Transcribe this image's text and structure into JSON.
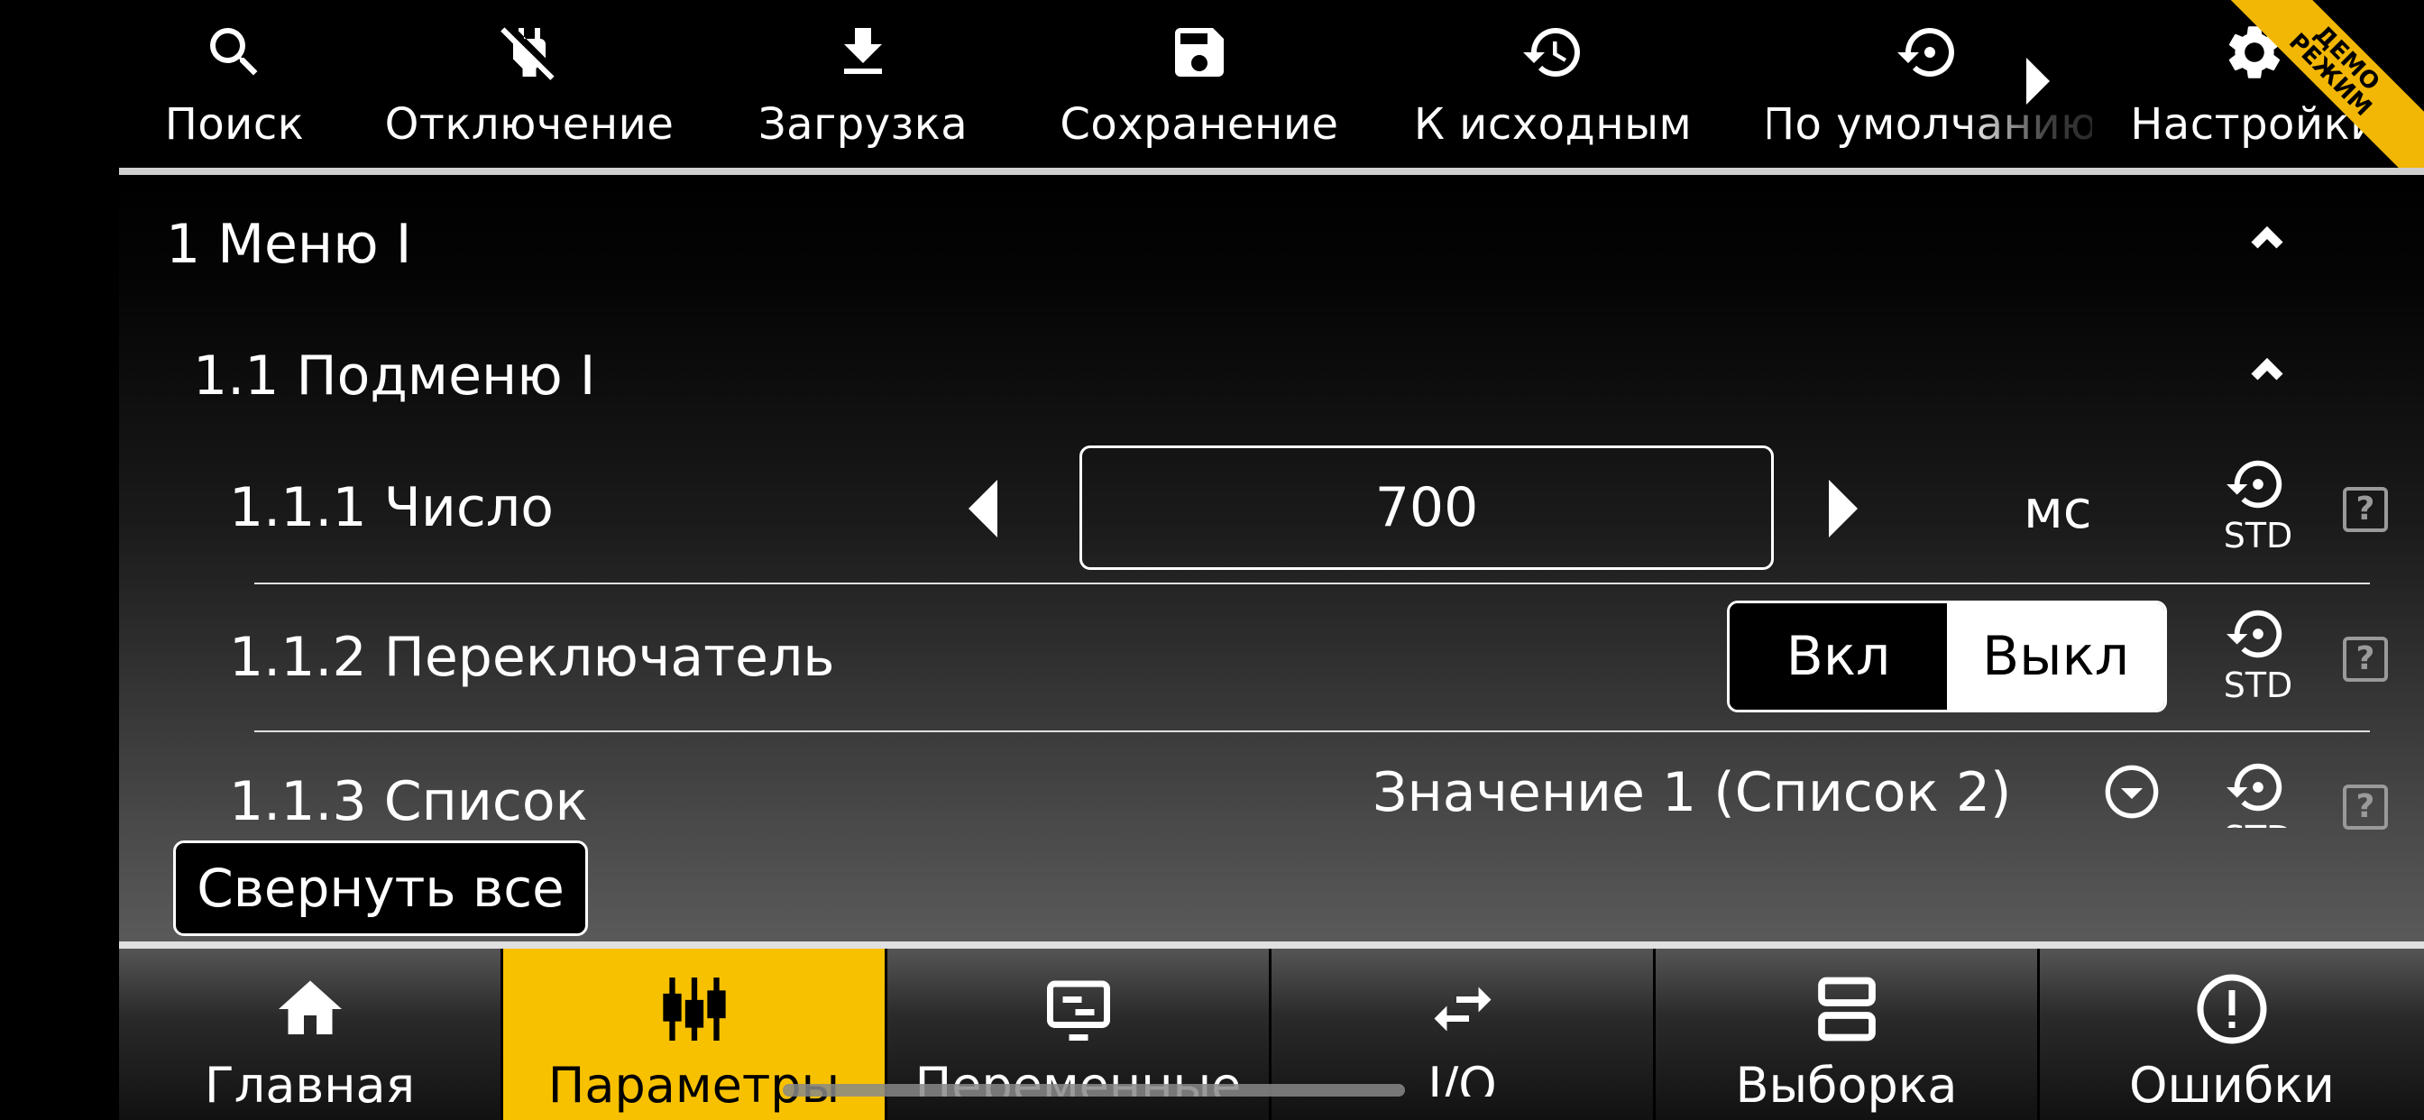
{
  "toolbar": {
    "items": [
      {
        "label": "Поиск",
        "icon": "search-icon"
      },
      {
        "label": "Отключение",
        "icon": "power-off-icon"
      },
      {
        "label": "Загрузка",
        "icon": "download-icon"
      },
      {
        "label": "Сохранение",
        "icon": "save-icon"
      },
      {
        "label": "К исходным",
        "icon": "history-icon"
      },
      {
        "label": "По умолчанию",
        "icon": "restore-icon"
      },
      {
        "label": "Настройки",
        "icon": "gear-icon"
      }
    ],
    "demo_badge_line1": "ДЕМО",
    "demo_badge_line2": "РЕЖИМ",
    "demo_badge_color": "#f2b705"
  },
  "content": {
    "menu_title": "1 Меню I",
    "submenu_title": "1.1 Подменю I",
    "rows": [
      {
        "label": "1.1.1 Число",
        "value": "700",
        "unit": "мс",
        "std_label": "STD",
        "help": "?"
      },
      {
        "label": "1.1.2 Переключатель",
        "on_label": "Вкл",
        "off_label": "Выкл",
        "selected": "Выкл",
        "std_label": "STD",
        "help": "?"
      },
      {
        "label": "1.1.3 Список",
        "value": "Значение 1 (Список 2)",
        "std_label": "STD",
        "help": "?"
      }
    ],
    "collapse_all": "Свернуть все"
  },
  "bottomnav": {
    "tabs": [
      {
        "label": "Главная",
        "icon": "home-icon",
        "active": false
      },
      {
        "label": "Параметры",
        "icon": "sliders-icon",
        "active": true
      },
      {
        "label": "Переменные",
        "icon": "variables-icon",
        "active": false
      },
      {
        "label": "I/O",
        "icon": "swap-icon",
        "active": false
      },
      {
        "label": "Выборка",
        "icon": "selection-icon",
        "active": false
      },
      {
        "label": "Ошибки",
        "icon": "error-icon",
        "active": false
      }
    ],
    "accent_color": "#f7c100"
  }
}
